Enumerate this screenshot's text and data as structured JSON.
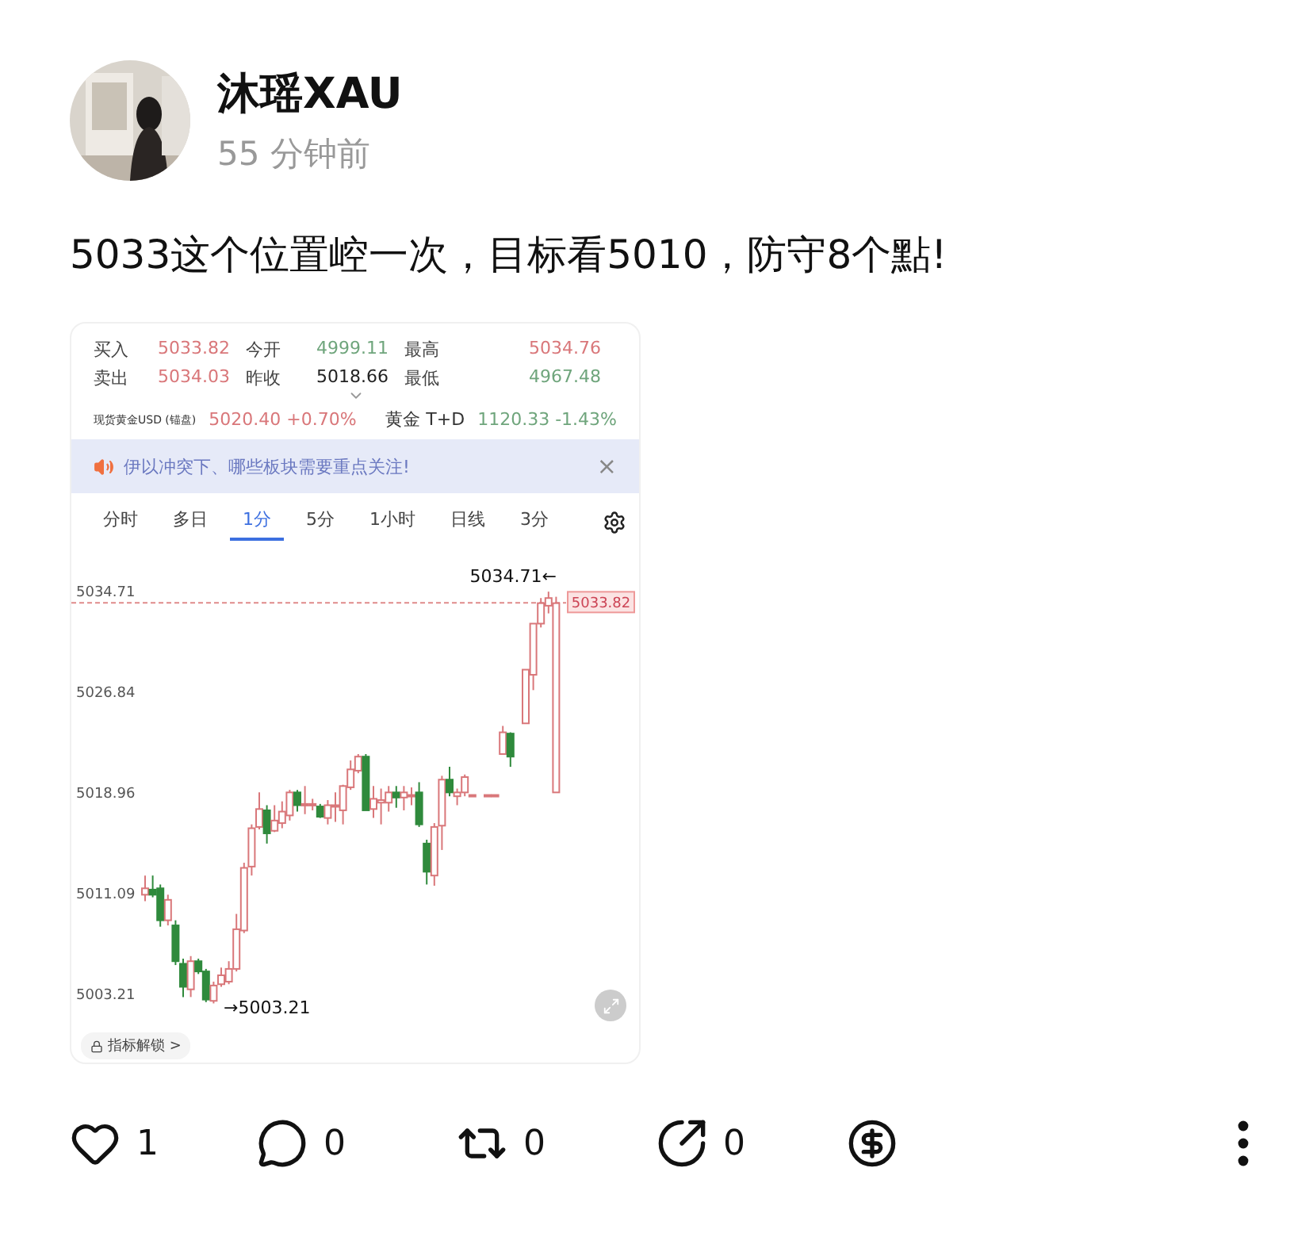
{
  "post": {
    "author": "沐瑶XAU",
    "time": "55 分钟前",
    "text": "5033这个位置崆一次，目标看5010，防守8个點!"
  },
  "quote": {
    "rows": [
      [
        {
          "label": "买入",
          "value": "5033.82",
          "color": "#d9777a"
        },
        {
          "label": "今开",
          "value": "4999.11",
          "color": "#6fa57c"
        },
        {
          "label": "最高",
          "value": "5034.76",
          "color": "#d9777a"
        }
      ],
      [
        {
          "label": "卖出",
          "value": "5034.03",
          "color": "#d9777a"
        },
        {
          "label": "昨收",
          "value": "5018.66",
          "color": "#222222"
        },
        {
          "label": "最低",
          "value": "4967.48",
          "color": "#6fa57c"
        }
      ]
    ],
    "tickers": [
      {
        "name": "现货黄金USD (锚盘)",
        "value": "5020.40 +0.70%",
        "color": "#d9777a",
        "kind": "fine"
      },
      {
        "name": "黄金 T+D",
        "value": "1120.33 -1.43%",
        "color": "#6fa57c",
        "kind": "plain"
      }
    ]
  },
  "banner": {
    "text": "伊以冲突下、哪些板块需要重点关注!",
    "close": "×"
  },
  "tabs": [
    {
      "label": "分时",
      "selected": false
    },
    {
      "label": "多日",
      "selected": false
    },
    {
      "label": "1分",
      "selected": true
    },
    {
      "label": "5分",
      "selected": false
    },
    {
      "label": "1小时",
      "selected": false
    },
    {
      "label": "日线",
      "selected": false
    },
    {
      "label": "3分",
      "selected": false
    }
  ],
  "chart": {
    "high_note": "5034.71←",
    "low_note": "→5003.21",
    "unlock": "指标解锁 >",
    "chart_data": {
      "type": "candlestick",
      "ylim": [
        5003.21,
        5034.71
      ],
      "ref_lines": [
        {
          "axis": "y",
          "value": 5033.82,
          "label": "5033.82"
        }
      ],
      "yticks": [
        {
          "value": 5034.71,
          "label": "5034.71"
        },
        {
          "value": 5026.84,
          "label": "5026.84"
        },
        {
          "value": 5018.96,
          "label": "5018.96"
        },
        {
          "value": 5011.09,
          "label": "5011.09"
        },
        {
          "value": 5003.21,
          "label": "5003.21"
        }
      ],
      "ohlc": [
        [
          5011,
          5012.5,
          5010.5,
          5011.5
        ],
        [
          5011.4,
          5012.5,
          5010.8,
          5011
        ],
        [
          5011.5,
          5011.8,
          5008.5,
          5009
        ],
        [
          5009,
          5011,
          5008.6,
          5010.6
        ],
        [
          5008.6,
          5009,
          5005.5,
          5005.8
        ],
        [
          5005.6,
          5006,
          5003,
          5003.8
        ],
        [
          5003.6,
          5006.2,
          5003,
          5005.8
        ],
        [
          5005.8,
          5006,
          5004.8,
          5005
        ],
        [
          5005,
          5005.2,
          5002.6,
          5002.8
        ],
        [
          5002.7,
          5004.2,
          5002.5,
          5003.9
        ],
        [
          5004,
          5005.3,
          5003.8,
          5004.7
        ],
        [
          5004.2,
          5005.8,
          5004,
          5005.2
        ],
        [
          5005.2,
          5009.5,
          5005,
          5008.3
        ],
        [
          5008.2,
          5013.5,
          5008,
          5013.1
        ],
        [
          5013.2,
          5016.5,
          5012.5,
          5016.2
        ],
        [
          5016.3,
          5019,
          5016.1,
          5017.7
        ],
        [
          5017.6,
          5018,
          5015,
          5015.8
        ],
        [
          5016,
          5018,
          5015.9,
          5016.8
        ],
        [
          5016.6,
          5018.3,
          5016.2,
          5017.5
        ],
        [
          5017.2,
          5019.2,
          5016.8,
          5019
        ],
        [
          5019,
          5019.2,
          5017.5,
          5018
        ],
        [
          5018,
          5019.5,
          5017.3,
          5018.1
        ],
        [
          5018,
          5018.5,
          5017.6,
          5018.1
        ],
        [
          5017.9,
          5018.1,
          5017,
          5017.1
        ],
        [
          5017,
          5018.4,
          5016.5,
          5018
        ],
        [
          5018,
          5019,
          5016.7,
          5018
        ],
        [
          5017.6,
          5019.6,
          5016.5,
          5019.5
        ],
        [
          5019.4,
          5021.5,
          5019.2,
          5020.8
        ],
        [
          5020.7,
          5022,
          5020.5,
          5021.8
        ],
        [
          5021.8,
          5022,
          5017.6,
          5017.6
        ],
        [
          5017.7,
          5019.5,
          5017,
          5018.5
        ],
        [
          5018.2,
          5019.3,
          5016.5,
          5018.4
        ],
        [
          5018.2,
          5019.5,
          5017.5,
          5019
        ],
        [
          5019,
          5019.5,
          5017.8,
          5018.6
        ],
        [
          5018.6,
          5019.5,
          5017.6,
          5019
        ],
        [
          5018.7,
          5019.4,
          5018,
          5018.8
        ],
        [
          5019,
          5019.8,
          5016.3,
          5016.5
        ],
        [
          5015,
          5015.3,
          5011.8,
          5012.8
        ],
        [
          5012.5,
          5016.6,
          5011.7,
          5016.3
        ],
        [
          5016.4,
          5020.3,
          5014.5,
          5020
        ],
        [
          5020,
          5021,
          5018.7,
          5019
        ],
        [
          5018.7,
          5019.3,
          5018,
          5019
        ],
        [
          5019,
          5020.4,
          5018.7,
          5020.2
        ],
        [
          5018.8,
          5018.8,
          5018.8,
          5018.8
        ],
        null,
        [
          5018.8,
          5018.8,
          5018.8,
          5018.8
        ],
        [
          5018.8,
          5018.8,
          5018.8,
          5018.8
        ],
        [
          5022,
          5024.2,
          5022,
          5023.7
        ],
        [
          5023.6,
          5023.7,
          5021,
          5021.8
        ],
        null,
        [
          5024.4,
          5028.6,
          5024.4,
          5028.6
        ],
        [
          5028.2,
          5032.2,
          5027,
          5032.2
        ],
        [
          5032.2,
          5034.2,
          5031.9,
          5033.8
        ],
        [
          5033.6,
          5034.7,
          5033,
          5034.2
        ],
        [
          5019,
          5034.3,
          5019,
          5033.8
        ]
      ]
    }
  },
  "actions": [
    {
      "kind": "like",
      "count": "1"
    },
    {
      "kind": "comment",
      "count": "0"
    },
    {
      "kind": "repost",
      "count": "0"
    },
    {
      "kind": "share",
      "count": "0"
    },
    {
      "kind": "tip"
    },
    {
      "kind": "more"
    }
  ]
}
